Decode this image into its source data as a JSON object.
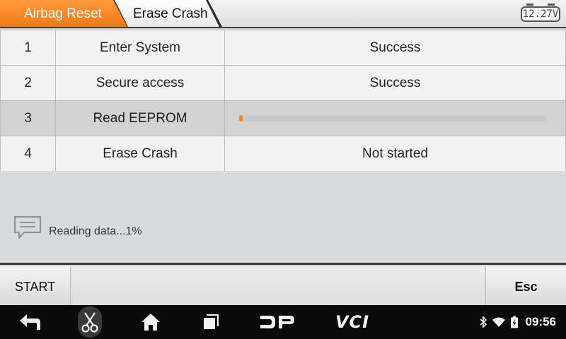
{
  "breadcrumbs": [
    {
      "label": "Airbag Reset"
    },
    {
      "label": "Erase Crash"
    }
  ],
  "battery_voltage": "12.27V",
  "steps": [
    {
      "num": "1",
      "name": "Enter System",
      "status": "Success"
    },
    {
      "num": "2",
      "name": "Secure access",
      "status": "Success"
    },
    {
      "num": "3",
      "name": "Read EEPROM",
      "progress_percent": 1
    },
    {
      "num": "4",
      "name": "Erase Crash",
      "status": "Not started"
    }
  ],
  "message": {
    "icon": "chat-bubble-icon",
    "text": "Reading data...1%"
  },
  "buttons": {
    "start_label": "START",
    "esc_label": "Esc"
  },
  "navbar": {
    "icons": [
      "back-icon",
      "scissors-icon",
      "home-icon",
      "recents-icon",
      "dp-logo-icon"
    ],
    "vci_label": "VCI",
    "clock": "09:56",
    "status_icons": [
      "bluetooth-icon",
      "wifi-icon",
      "battery-icon"
    ]
  },
  "colors": {
    "accent": "#f07a12",
    "progress": "#f08a24"
  }
}
